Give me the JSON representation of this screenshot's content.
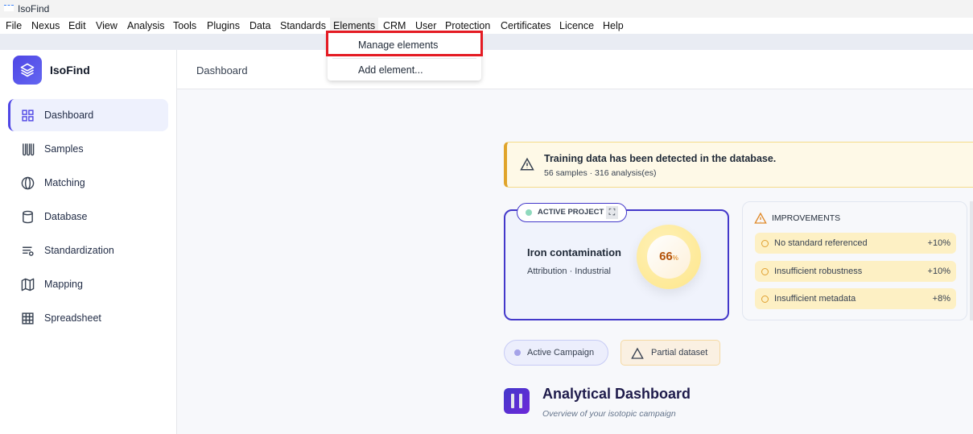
{
  "window": {
    "title": "IsoFind"
  },
  "menu": [
    "File",
    "Nexus",
    "Edit",
    "View",
    "Analysis",
    "Tools",
    "Plugins",
    "Data",
    "Standards",
    "Elements",
    "CRM",
    "User",
    "Protection",
    "Certificates",
    "Licence",
    "Help"
  ],
  "dropdown": {
    "items": [
      "Manage elements",
      "Add element..."
    ],
    "highlighted": "Manage elements"
  },
  "sidebar": {
    "app_name": "IsoFind",
    "items": [
      {
        "label": "Dashboard",
        "icon": "grid-icon",
        "active": true
      },
      {
        "label": "Samples",
        "icon": "test-tubes-icon"
      },
      {
        "label": "Matching",
        "icon": "globe-icon"
      },
      {
        "label": "Database",
        "icon": "cylinder-icon"
      },
      {
        "label": "Standardization",
        "icon": "list-settings-icon"
      },
      {
        "label": "Mapping",
        "icon": "map-icon"
      },
      {
        "label": "Spreadsheet",
        "icon": "table-icon"
      }
    ]
  },
  "header": {
    "title": "Dashboard"
  },
  "alert": {
    "title": "Training data has been detected in the database.",
    "detail": "56 samples · 316 analysis(es)"
  },
  "project": {
    "badge": "ACTIVE PROJECT",
    "name": "Iron contamination",
    "meta": "Attribution · Industrial",
    "score": "66",
    "unit": "%"
  },
  "improvements": {
    "title": "IMPROVEMENTS",
    "items": [
      {
        "label": "No standard referenced",
        "value": "+10%"
      },
      {
        "label": "Insufficient robustness",
        "value": "+10%"
      },
      {
        "label": "Insufficient metadata",
        "value": "+8%"
      }
    ]
  },
  "pills": {
    "campaign": "Active Campaign",
    "dataset": "Partial dataset"
  },
  "dashboard": {
    "title": "Analytical Dashboard",
    "subtitle": "Overview of your isotopic campaign"
  },
  "colors": {
    "accent": "#4f46e5",
    "alert_border": "#e0a42a",
    "highlight_box": "#e41b23"
  }
}
